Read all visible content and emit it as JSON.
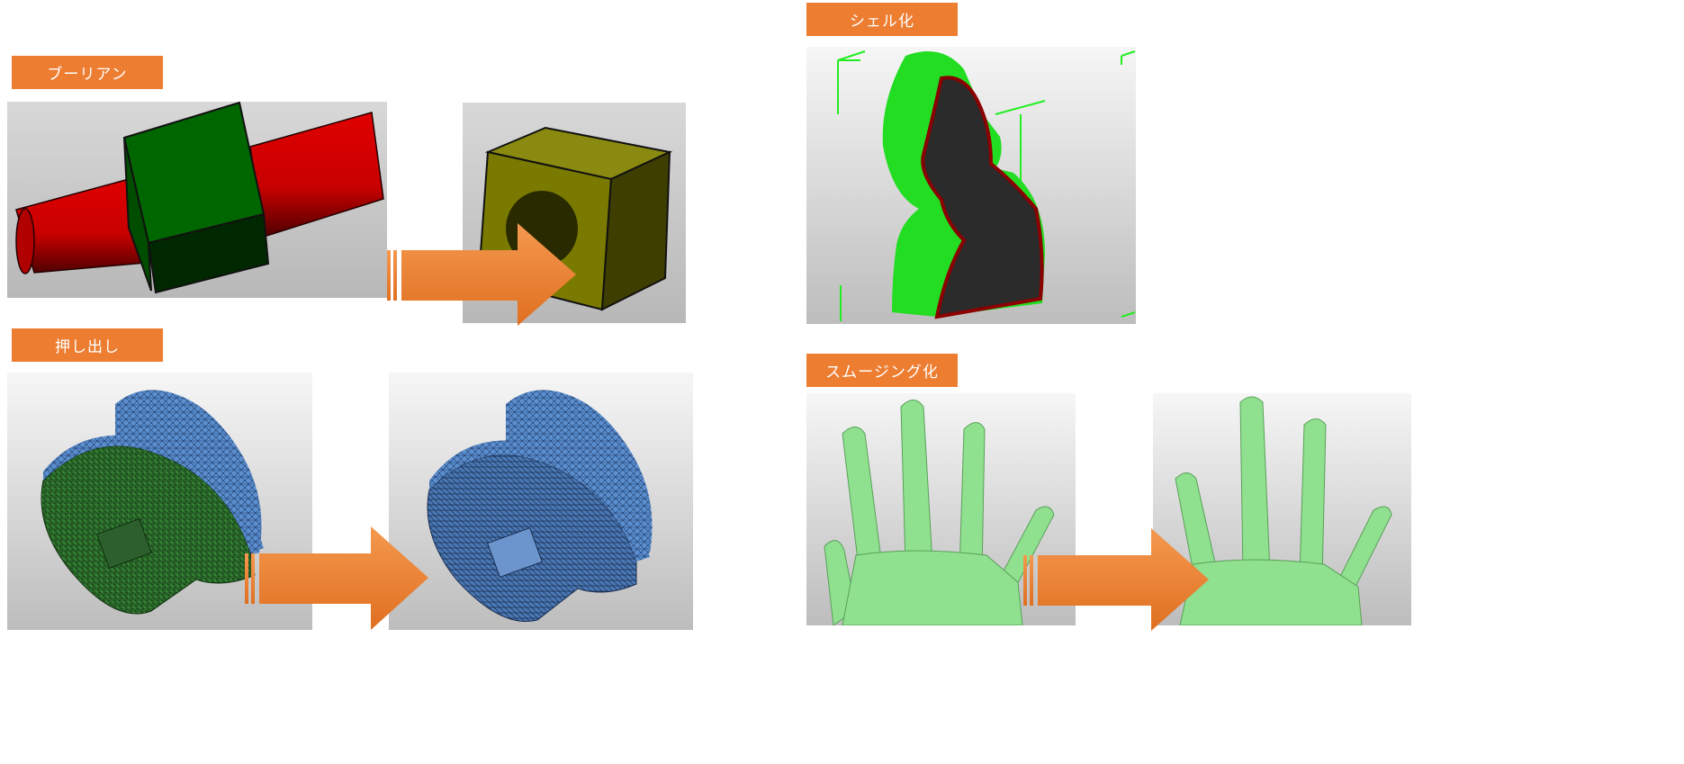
{
  "sections": {
    "boolean": {
      "label": "ブーリアン"
    },
    "extrude": {
      "label": "押し出し"
    },
    "shell": {
      "label": "シェル化"
    },
    "smoothing": {
      "label": "スムージング化"
    }
  },
  "colors": {
    "label_bg": "#ED7D31",
    "label_text": "#FFFFFF",
    "arrow": "#ED7D31",
    "cylinder": "#D40000",
    "cube": "#006600",
    "result_cube": "#7A7A00",
    "mesh": "#5A8FD0",
    "bust": "#22DD22",
    "hand": "#8FE08F"
  },
  "icons": [
    "arrow-right-icon"
  ]
}
